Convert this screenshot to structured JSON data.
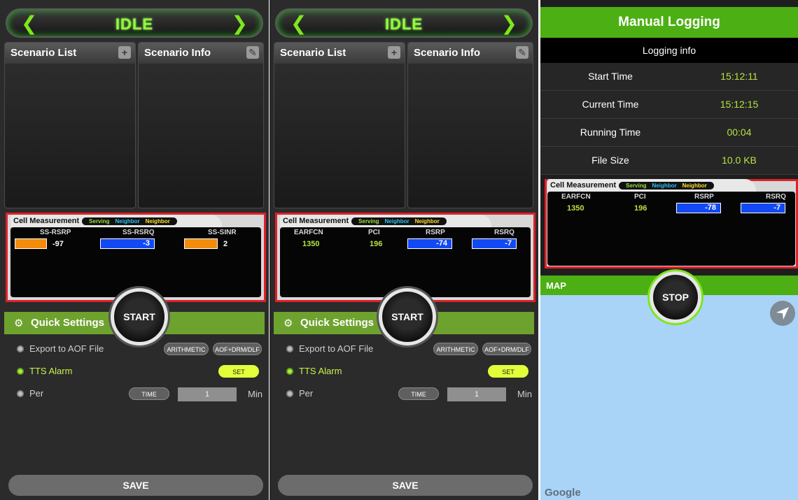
{
  "status": {
    "state": "IDLE",
    "prev_icon": "chevron-left-icon",
    "next_icon": "chevron-right-icon"
  },
  "scenario": {
    "list_title": "Scenario List",
    "info_title": "Scenario Info"
  },
  "cell_measurement": {
    "title": "Cell Measurement",
    "tabs": [
      "Serving",
      "Neighbor",
      "Neighbor"
    ],
    "nr": {
      "cols": [
        "SS-RSRP",
        "SS-RSRQ",
        "SS-SINR"
      ],
      "rsrp": "-97",
      "rsrq": "-3",
      "sinr": "2"
    },
    "lte": {
      "cols": [
        "EARFCN",
        "PCI",
        "RSRP",
        "RSRQ"
      ],
      "earfcn": "1350",
      "pci": "196",
      "rsrp": "-74",
      "rsrq": "-7"
    },
    "lte3": {
      "earfcn": "1350",
      "pci": "196",
      "rsrp": "-78",
      "rsrq": "-7"
    }
  },
  "quick_settings": {
    "title": "Quick Settings",
    "start_label": "START",
    "export_label": "Export to AOF File",
    "arithmetic_label": "ARITHMETIC",
    "aof_label": "AOF+DRM/DLF",
    "tts_label": "TTS Alarm",
    "set_label": "SET",
    "per_label": "Per",
    "time_label": "TIME",
    "per_value": "1",
    "per_unit": "Min",
    "save_label": "SAVE"
  },
  "manual_logging": {
    "title": "Manual Logging",
    "info_title": "Logging info",
    "rows": [
      {
        "label": "Start Time",
        "value": "15:12:11"
      },
      {
        "label": "Current Time",
        "value": "15:12:15"
      },
      {
        "label": "Running Time",
        "value": "00:04"
      },
      {
        "label": "File Size",
        "value": "10.0 KB"
      }
    ],
    "map_label": "MAP",
    "stop_label": "STOP",
    "google_label": "Google"
  },
  "colors": {
    "accent_green": "#4caf13",
    "highlight_red": "#e0202a",
    "bar_orange": "#f28c0a",
    "bar_blue": "#1249f5"
  }
}
